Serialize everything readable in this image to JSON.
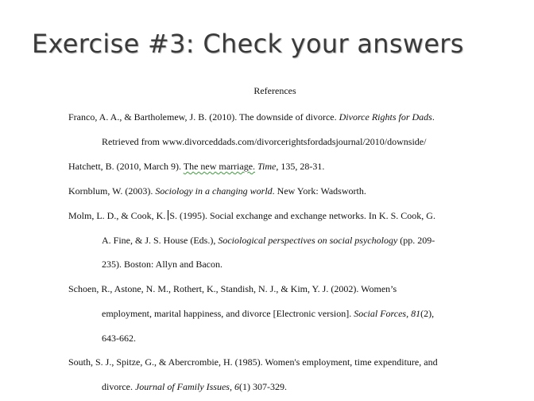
{
  "slide": {
    "title": "Exercise #3: Check your answers"
  },
  "document": {
    "heading": "References",
    "references": [
      {
        "line1": [
          "Franco, A. A., & Bartholemew, J. B. (2010). The downside of divorce. ",
          "Divorce Rights for Dads",
          "."
        ],
        "line2": [
          "Retrieved from www.divorceddads.com/divorcerightsfordadsjournal/2010/downside/"
        ]
      },
      {
        "line1": [
          "Hatchett, B. (2010, March 9).  ",
          "The new marriage.",
          "  ",
          "Time",
          ", 135, 28-31."
        ]
      },
      {
        "line1": [
          "Kornblum, W. (2003). ",
          "Sociology in a changing world",
          ". New York: Wadsworth."
        ]
      },
      {
        "line1": [
          "Molm, L. D., & Cook, K. ",
          "S. (1995). Social exchange and exchange networks. In K. S. Cook, G."
        ],
        "line2": [
          "A. Fine, & J. S. House (Eds.), ",
          "Sociological perspectives on social psychology",
          " (pp. 209-"
        ],
        "line3": [
          "235). Boston: Allyn and Bacon."
        ]
      },
      {
        "line1": [
          "Schoen, R., Astone, N. M., Rothert, K., Standish, N. J., & Kim, Y. J.  (2002).  Women’s"
        ],
        "line2": [
          "employment, marital happiness, and divorce [Electronic version].  ",
          "Social Forces, 81",
          "(2),"
        ],
        "line3": [
          "643-662."
        ]
      },
      {
        "line1": [
          "South, S. J., Spitze, G., & Abercrombie, H. (1985). Women's employment, time expenditure, and"
        ],
        "line2": [
          "divorce. ",
          "Journal of Family Issues, 6",
          "(1) 307-329."
        ]
      }
    ]
  }
}
